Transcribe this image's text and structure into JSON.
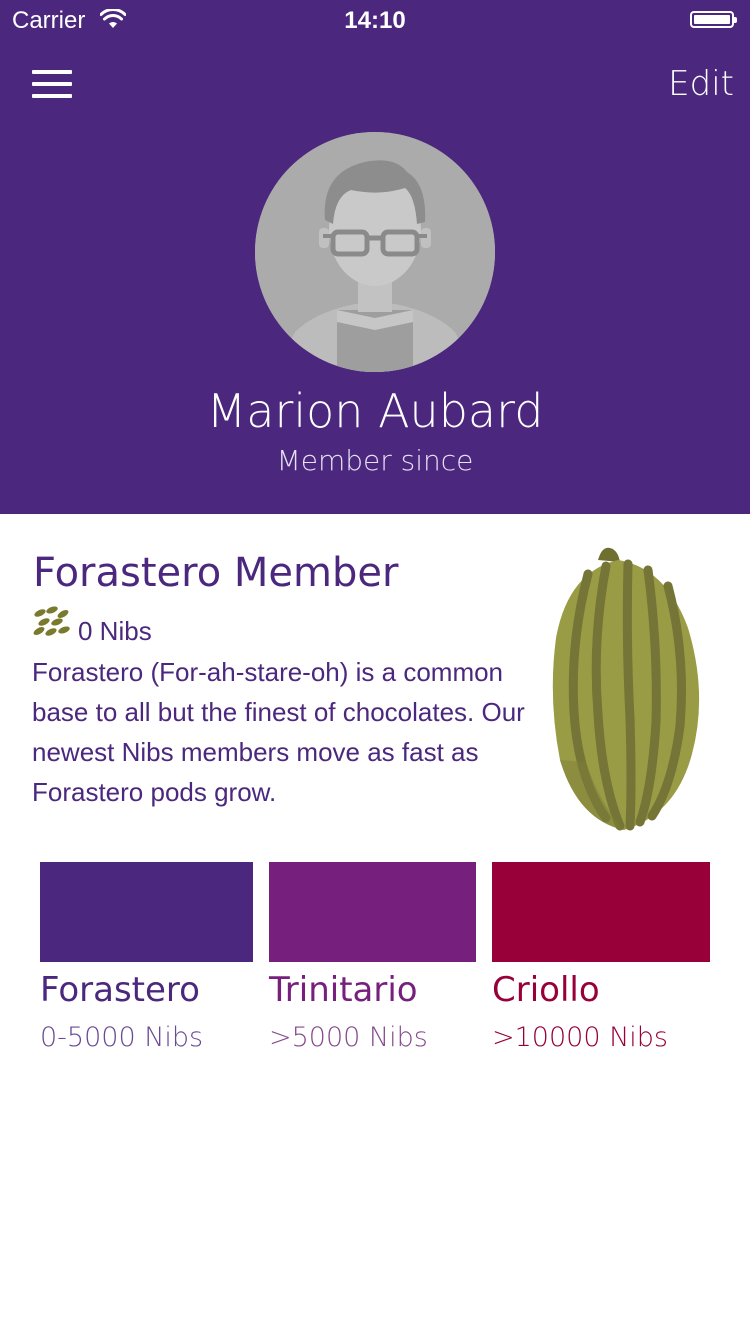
{
  "status_bar": {
    "carrier": "Carrier",
    "time": "14:10",
    "wifi_icon": "wifi-icon",
    "battery_icon": "battery-icon"
  },
  "nav": {
    "menu_icon": "hamburger-menu-icon",
    "edit_label": "Edit"
  },
  "profile": {
    "avatar_icon": "default-avatar-icon",
    "name": "Marion Aubard",
    "member_since": "Member since"
  },
  "membership": {
    "title": "Forastero Member",
    "nibs_icon": "nibs-icon",
    "nibs": "0 Nibs",
    "description": "Forastero (For-ah-stare-oh) is a common base to all but the finest of chocolates. Our newest Nibs members move as fast as Forastero pods grow.",
    "pod_icon": "cacao-pod-icon"
  },
  "tiers": [
    {
      "name": "Forastero",
      "range": "0-5000 Nibs",
      "color": "#4b287d"
    },
    {
      "name": "Trinitario",
      "range": ">5000 Nibs",
      "color": "#761f7c"
    },
    {
      "name": "Criollo",
      "range": ">10000 Nibs",
      "color": "#970039"
    }
  ],
  "colors": {
    "header_bg": "#4b287d",
    "accent": "#4b287d",
    "nibs_icon": "#7a7a2e",
    "pod": "#9a9b45"
  }
}
